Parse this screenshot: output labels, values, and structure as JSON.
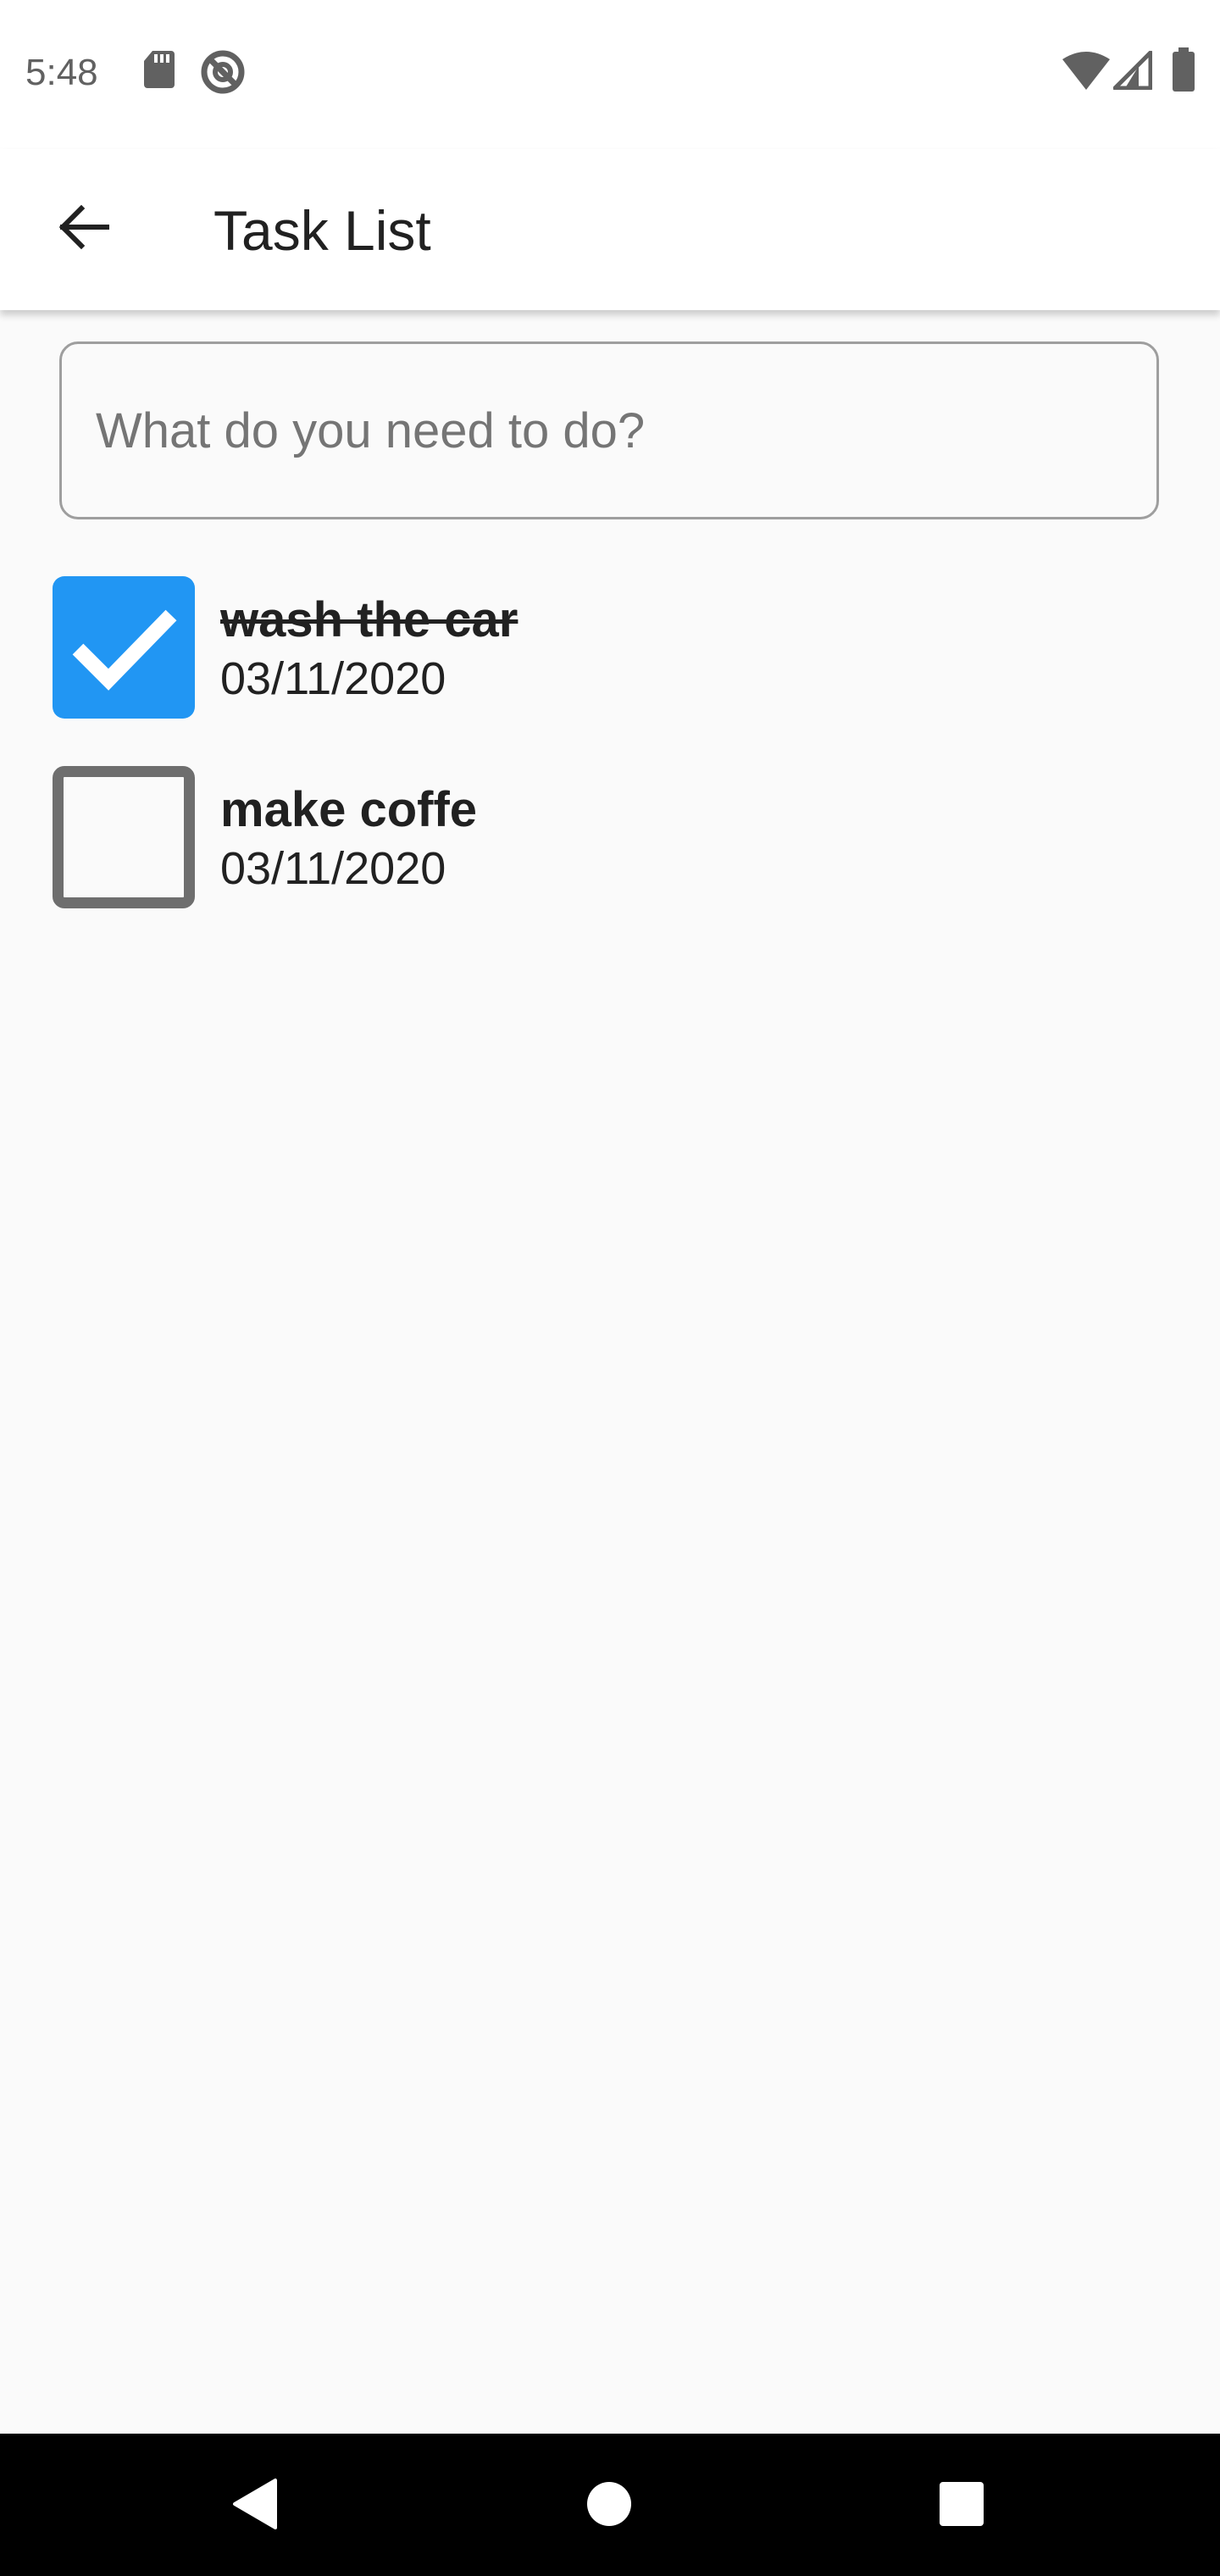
{
  "status_bar": {
    "time": "5:48",
    "icons": [
      "sd-card-icon",
      "do-not-disturb-icon",
      "wifi-icon",
      "cell-signal-icon",
      "battery-icon"
    ]
  },
  "app_bar": {
    "back_icon": "arrow-back-icon",
    "title": "Task List"
  },
  "new_task": {
    "placeholder": "What do you need to do?",
    "value": ""
  },
  "tasks": [
    {
      "title": "wash the car",
      "date": "03/11/2020",
      "done": true
    },
    {
      "title": "make coffe",
      "date": "03/11/2020",
      "done": false
    }
  ],
  "nav_bar": {
    "icons": [
      "nav-back-icon",
      "nav-home-icon",
      "nav-recents-icon"
    ]
  },
  "colors": {
    "accent": "#2196f3",
    "background": "#fafafa",
    "app_bar": "#ffffff",
    "nav_bar": "#000000",
    "unchecked_border": "#6e6e6e"
  }
}
